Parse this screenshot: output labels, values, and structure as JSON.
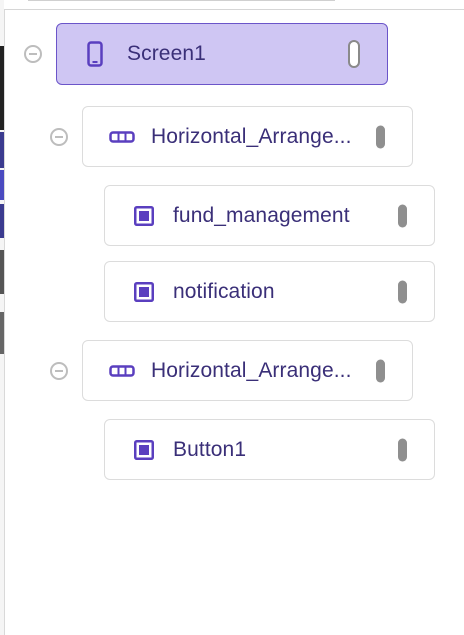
{
  "tree": {
    "screen": {
      "label": "Screen1",
      "icon": "phone-icon",
      "selected": true
    },
    "arrangement1": {
      "label": "Horizontal_Arrange...",
      "icon": "horizontal-arrangement-icon",
      "children": [
        {
          "label": "fund_management",
          "icon": "button-component-icon"
        },
        {
          "label": "notification",
          "icon": "button-component-icon"
        }
      ]
    },
    "arrangement2": {
      "label": "Horizontal_Arrange...",
      "icon": "horizontal-arrangement-icon",
      "children": [
        {
          "label": "Button1",
          "icon": "button-component-icon"
        }
      ]
    }
  },
  "colors": {
    "accent": "#5a3fbf",
    "selected_background": "#cfc6f3",
    "label_text": "#3a2f78",
    "handle": "#8f8f8f"
  }
}
